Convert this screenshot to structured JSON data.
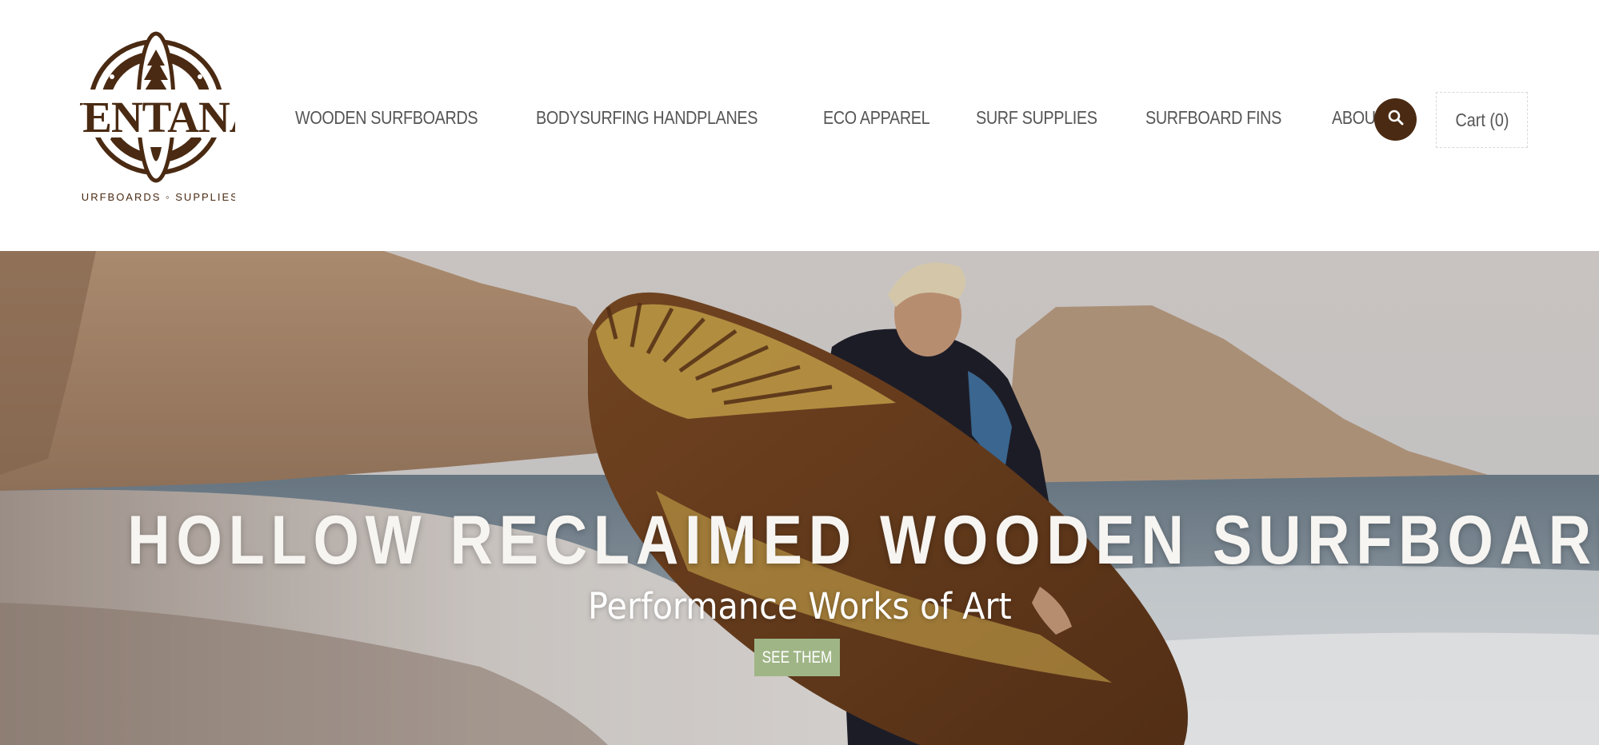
{
  "brand": {
    "logo_text": "VENTANA",
    "logo_tagline": "SURFBOARDS & SUPPLIES",
    "color": "#4a2a12"
  },
  "nav": {
    "items": [
      {
        "label": "WOODEN SURFBOARDS"
      },
      {
        "label": "BODYSURFING HANDPLANES"
      },
      {
        "label": "ECO APPAREL"
      },
      {
        "label": "SURF SUPPLIES"
      },
      {
        "label": "SURFBOARD FINS"
      },
      {
        "label": "ABOUT",
        "icon": "chevron-down-icon"
      }
    ]
  },
  "header_actions": {
    "search_icon": "search-icon",
    "cart_label": "Cart (0)"
  },
  "hero": {
    "title": "HOLLOW RECLAIMED WOODEN SURFBOARDS",
    "subtitle": "Performance Works of Art",
    "cta_label": "SEE THEM",
    "cta_color": "#9fb586"
  }
}
